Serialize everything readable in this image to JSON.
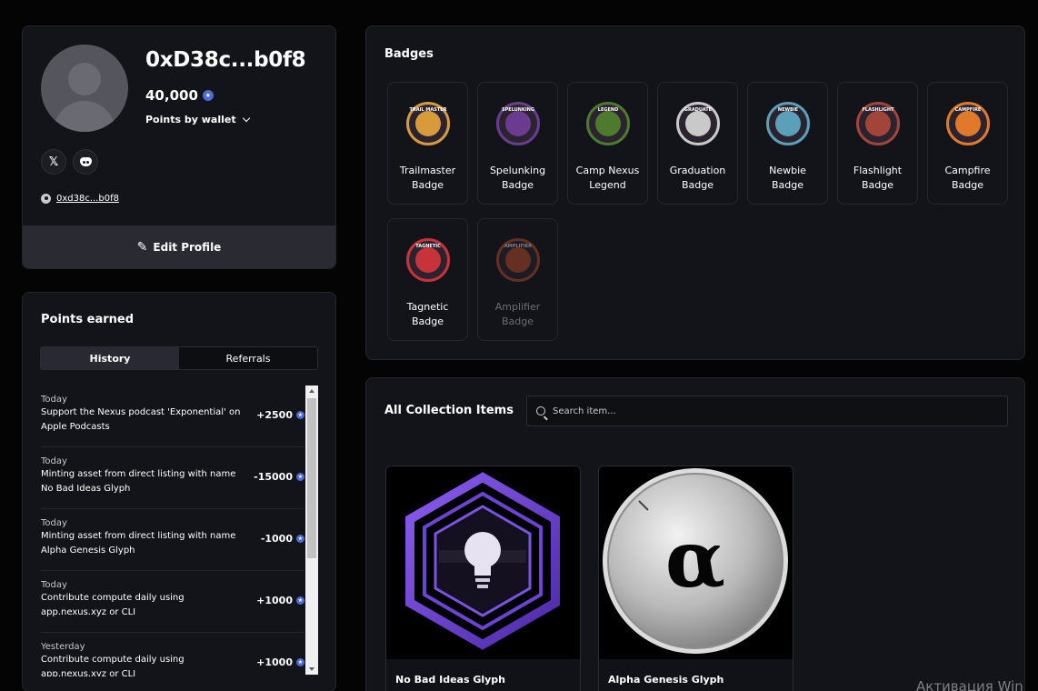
{
  "profile": {
    "username": "0xD38c...b0f8",
    "points": "40,000",
    "points_star": "★",
    "wallet_dropdown": "Points by wallet",
    "x_label": "𝕏",
    "address": "0xd38c...b0f8",
    "edit_label": "Edit Profile",
    "edit_icon": "✎"
  },
  "points_earned": {
    "title": "Points earned",
    "tabs": [
      {
        "label": "History"
      },
      {
        "label": "Referrals"
      }
    ],
    "entries": [
      {
        "date": "Today",
        "description": "Support the Nexus podcast 'Exponential' on Apple Podcasts",
        "delta": "+2500"
      },
      {
        "date": "Today",
        "description": "Minting asset from direct listing with name No Bad Ideas Glyph",
        "delta": "-15000"
      },
      {
        "date": "Today",
        "description": "Minting asset from direct listing with name Alpha Genesis Glyph",
        "delta": "-1000"
      },
      {
        "date": "Today",
        "description": "Contribute compute daily using app.nexus.xyz or CLI",
        "delta": "+1000"
      },
      {
        "date": "Yesterday",
        "description": "Contribute compute daily using app.nexus.xyz or CLI",
        "delta": "+1000"
      }
    ]
  },
  "badges": {
    "title": "Badges",
    "items": [
      {
        "label": "Trailmaster Badge",
        "ring": "TRAIL MASTER",
        "color": "#d89a3a",
        "enabled": true
      },
      {
        "label": "Spelunking Badge",
        "ring": "SPELUNKING",
        "color": "#6a3b8f",
        "enabled": true
      },
      {
        "label": "Camp Nexus Legend",
        "ring": "LEGEND",
        "color": "#4d7a2c",
        "enabled": true
      },
      {
        "label": "Graduation Badge",
        "ring": "GRADUATE",
        "color": "#c9c9c9",
        "enabled": true
      },
      {
        "label": "Newbie Badge",
        "ring": "NEWBIE",
        "color": "#5aa0b8",
        "enabled": true
      },
      {
        "label": "Flashlight Badge",
        "ring": "FLASHLIGHT",
        "color": "#a3443a",
        "enabled": true
      },
      {
        "label": "Campfire Badge",
        "ring": "CAMPFIRE",
        "color": "#e07a2a",
        "enabled": true
      },
      {
        "label": "Tagnetic Badge",
        "ring": "TAGNETIC",
        "color": "#c8333a",
        "enabled": true
      },
      {
        "label": "Amplifier Badge",
        "ring": "AMPLIFIER",
        "color": "#c8512a",
        "enabled": false
      }
    ]
  },
  "collection": {
    "title": "All Collection Items",
    "search_placeholder": "Search item...",
    "items": [
      {
        "name": "No Bad Ideas Glyph"
      },
      {
        "name": "Alpha Genesis Glyph",
        "glyph": "α"
      }
    ]
  },
  "watermark": "Активация Win"
}
